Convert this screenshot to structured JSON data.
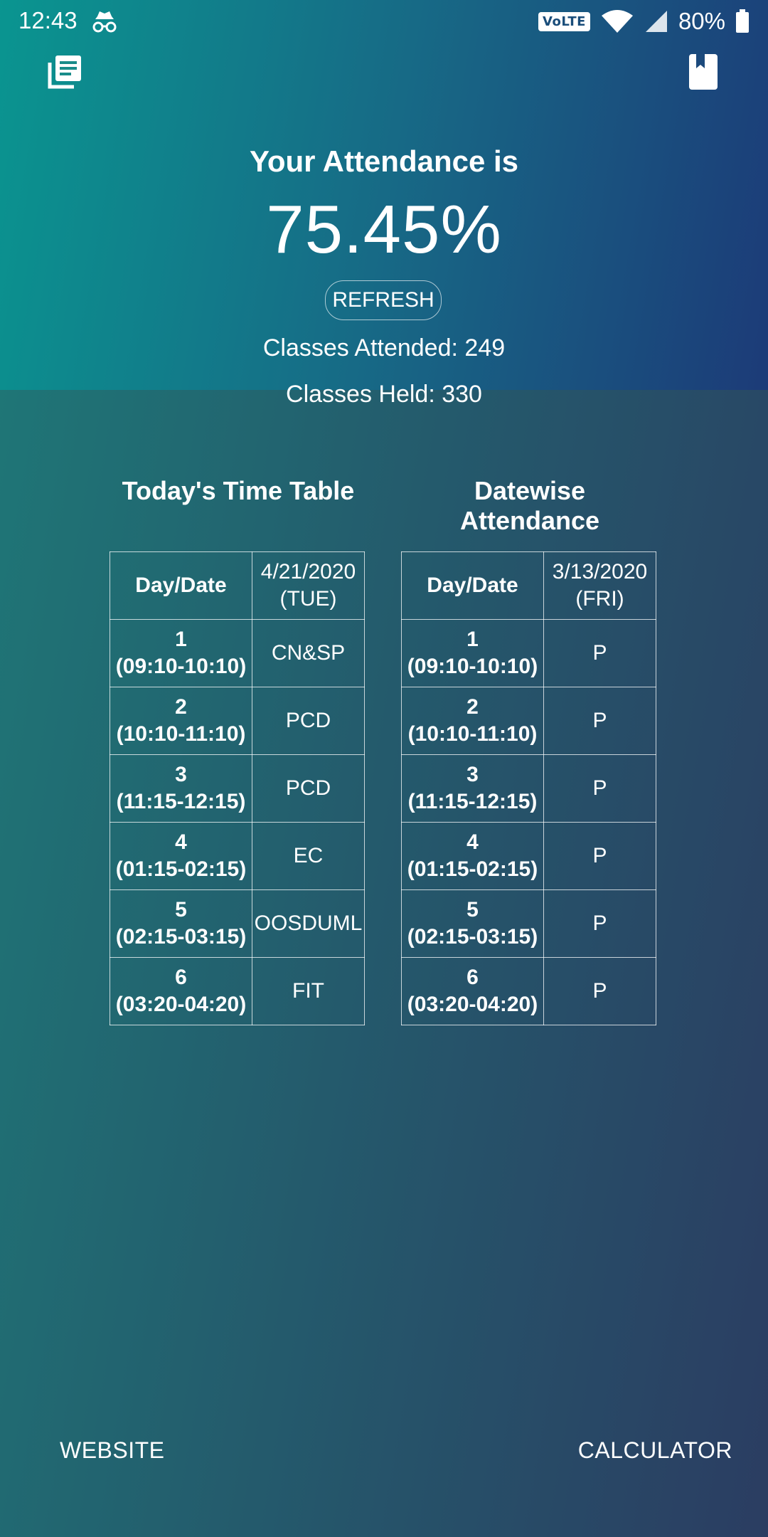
{
  "status_bar": {
    "time": "12:43",
    "network_badge": "VoLTE",
    "battery": "80%"
  },
  "toolbar": {
    "left_icon": "list-icon",
    "right_icon": "bookmark-icon"
  },
  "attendance": {
    "title": "Your Attendance is",
    "percent": "75.45%",
    "refresh_label": "REFRESH",
    "attended": "Classes Attended: 249",
    "held": "Classes Held: 330"
  },
  "timetable": {
    "heading": "Today's Time Table",
    "header_left": "Day/Date",
    "header_right_line1": "4/21/2020",
    "header_right_line2": "(TUE)",
    "rows": [
      {
        "num": "1",
        "time": "(09:10-10:10)",
        "value": "CN&SP"
      },
      {
        "num": "2",
        "time": "(10:10-11:10)",
        "value": "PCD"
      },
      {
        "num": "3",
        "time": "(11:15-12:15)",
        "value": "PCD"
      },
      {
        "num": "4",
        "time": "(01:15-02:15)",
        "value": "EC"
      },
      {
        "num": "5",
        "time": "(02:15-03:15)",
        "value": "OOSDUML"
      },
      {
        "num": "6",
        "time": "(03:20-04:20)",
        "value": "FIT"
      }
    ]
  },
  "datewise": {
    "heading": "Datewise Attendance",
    "header_left": "Day/Date",
    "header_right_line1": "3/13/2020",
    "header_right_line2": "(FRI)",
    "rows": [
      {
        "num": "1",
        "time": "(09:10-10:10)",
        "value": "P"
      },
      {
        "num": "2",
        "time": "(10:10-11:10)",
        "value": "P"
      },
      {
        "num": "3",
        "time": "(11:15-12:15)",
        "value": "P"
      },
      {
        "num": "4",
        "time": "(01:15-02:15)",
        "value": "P"
      },
      {
        "num": "5",
        "time": "(02:15-03:15)",
        "value": "P"
      },
      {
        "num": "6",
        "time": "(03:20-04:20)",
        "value": "P"
      }
    ]
  },
  "bottom": {
    "website_label": "WEBSITE",
    "calculator_label": "CALCULATOR"
  }
}
